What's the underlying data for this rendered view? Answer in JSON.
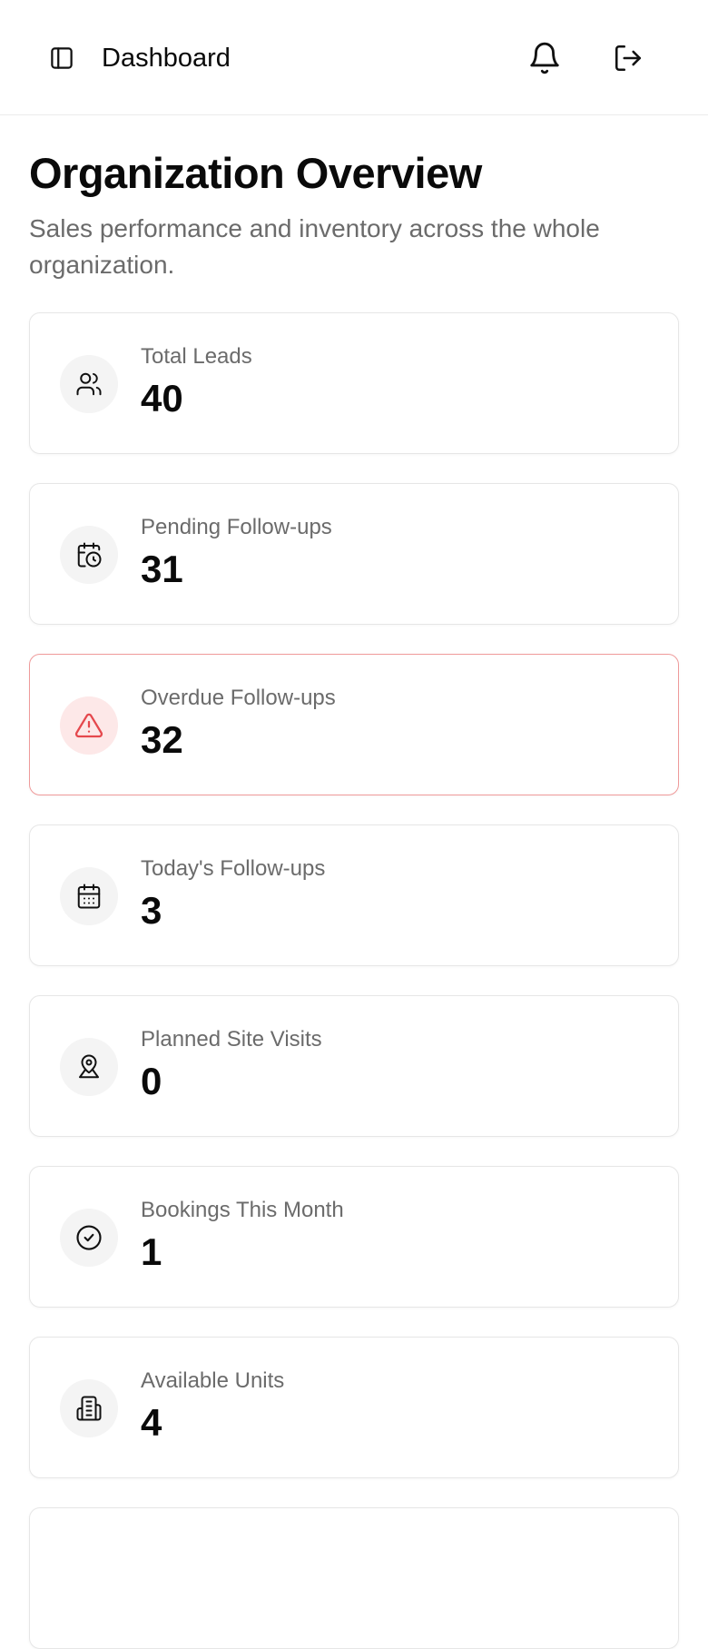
{
  "header": {
    "title": "Dashboard",
    "icons": {
      "sidebar_toggle": "sidebar-toggle-icon",
      "notifications": "bell-icon",
      "logout": "logout-icon"
    }
  },
  "page": {
    "title": "Organization Overview",
    "subtitle": "Sales performance and inventory across the whole organization."
  },
  "stats": [
    {
      "label": "Total Leads",
      "value": "40",
      "icon": "users-icon",
      "tone": "default"
    },
    {
      "label": "Pending Follow-ups",
      "value": "31",
      "icon": "calendar-clock-icon",
      "tone": "default"
    },
    {
      "label": "Overdue Follow-ups",
      "value": "32",
      "icon": "warning-triangle-icon",
      "tone": "alert"
    },
    {
      "label": "Today's Follow-ups",
      "value": "3",
      "icon": "calendar-icon",
      "tone": "default"
    },
    {
      "label": "Planned Site Visits",
      "value": "0",
      "icon": "map-pin-user-icon",
      "tone": "default"
    },
    {
      "label": "Bookings This Month",
      "value": "1",
      "icon": "check-circle-icon",
      "tone": "default"
    },
    {
      "label": "Available Units",
      "value": "4",
      "icon": "building-icon",
      "tone": "default"
    }
  ],
  "colors": {
    "alert_border": "#ef9a9a",
    "alert_icon": "#e5484d",
    "alert_icon_bg": "#fde8e8",
    "muted_text": "#6b6b6b"
  }
}
